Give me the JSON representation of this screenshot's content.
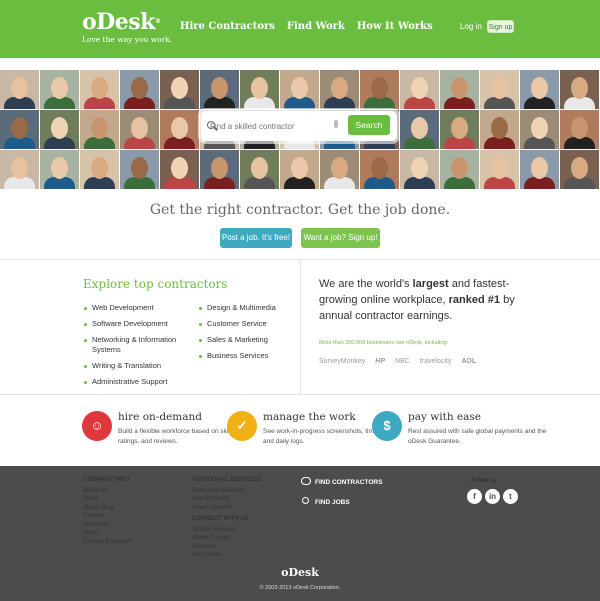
{
  "header": {
    "logo": "oDesk",
    "tagline": "Love the way you work.",
    "nav": [
      "Hire Contractors",
      "Find Work",
      "How It Works"
    ],
    "login": "Log in",
    "signup": "Sign up"
  },
  "search": {
    "placeholder": "Find a skilled contractor",
    "button": "Search"
  },
  "hero": {
    "headline": "Get the right contractor. Get the job done.",
    "cta_post": "Post a job. It's free!",
    "cta_work": "Want a job? Sign up!"
  },
  "explore": {
    "title": "Explore top contractors",
    "col1": [
      "Web Development",
      "Software Development",
      "Networking & Information Systems",
      "Writing & Translation",
      "Administrative Support"
    ],
    "col2": [
      "Design & Multimedia",
      "Customer Service",
      "Sales & Marketing",
      "Business Services"
    ]
  },
  "stats": {
    "line1": "We are the world's",
    "bold1": "largest",
    "line2": "and fastest-growing online workplace,",
    "bold2": "ranked #1",
    "line3": "by annual contractor earnings.",
    "business_count": "More than 350,000 businesses use oDesk, including:",
    "logos": [
      "SurveyMonkey",
      "HP",
      "NBC",
      "travelocity",
      "AOL"
    ]
  },
  "features": [
    {
      "title": "hire on-demand",
      "desc": "Build a flexible workforce based on skills, ratings, and reviews.",
      "color": "#e0373d"
    },
    {
      "title": "manage the work",
      "desc": "See work-in-progress screenshots, time sheets, and daily logs.",
      "color": "#f0b016"
    },
    {
      "title": "pay with ease",
      "desc": "Rest assured with safe global payments and the oDesk Guarantee.",
      "color": "#3daac2"
    }
  ],
  "footer": {
    "company_title": "COMPANY INFO",
    "company": [
      "About Us",
      "Press",
      "oDesk Blog",
      "Careers",
      "oConomy",
      "Legal",
      "Contact & Support"
    ],
    "additional_title": "ADDITIONAL SERVICES",
    "additional": [
      "Enterprise Solutions",
      "oDesk Payroll",
      "Health Benefits"
    ],
    "connect_title": "CONNECT WITH US",
    "connect": [
      "Affiliate Program",
      "oDesk Groups",
      "Partners",
      "API Center"
    ],
    "find_contractors": "FIND CONTRACTORS",
    "find_jobs": "FIND JOBS",
    "follow_us": "follow us",
    "social": [
      "f",
      "in",
      "t"
    ],
    "logo": "oDesk",
    "copyright": "© 2003-2013 oDesk Corporation."
  },
  "colors": {
    "brand_green": "#6bbd3f",
    "cta_blue": "#3daac2",
    "footer_gray": "#4c4c4c"
  }
}
